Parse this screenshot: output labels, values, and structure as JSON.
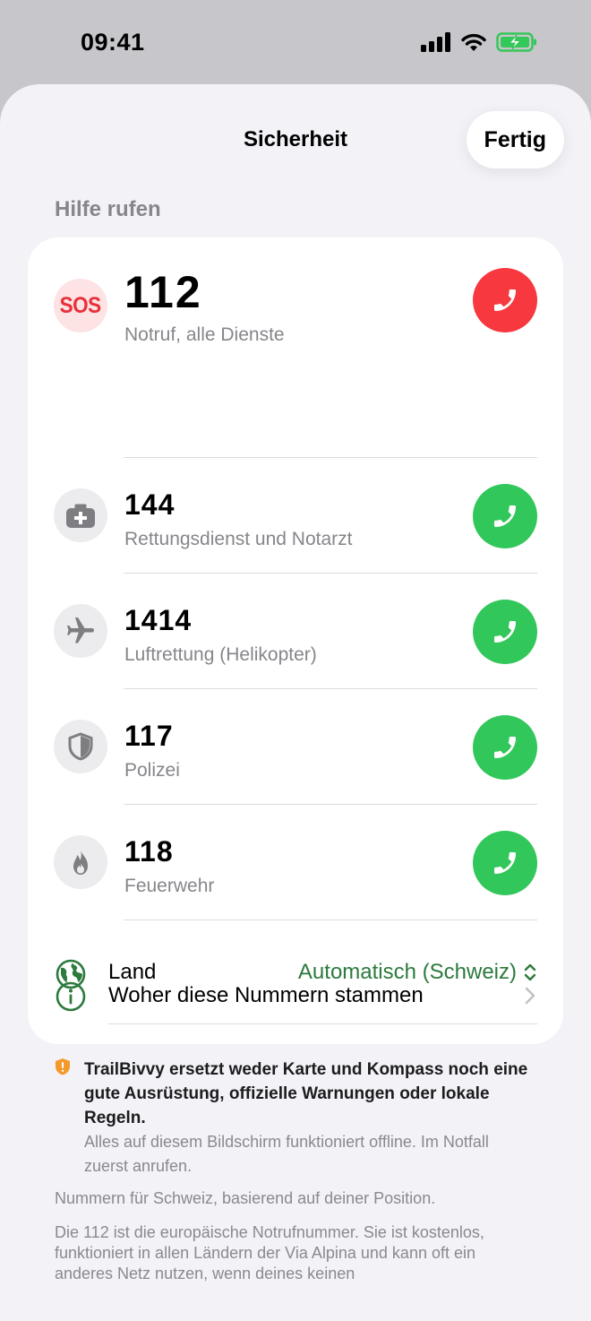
{
  "status_bar": {
    "time": "09:41"
  },
  "sheet": {
    "title": "Sicherheit",
    "done_label": "Fertig"
  },
  "section": {
    "header": "Hilfe rufen"
  },
  "contacts": [
    {
      "icon": "sos-icon",
      "number": "112",
      "description": "Notruf, alle Dienste",
      "call_color": "#f7383f"
    },
    {
      "icon": "medical-kit-icon",
      "number": "144",
      "description": "Rettungsdienst und Notarzt",
      "call_color": "#32c75a"
    },
    {
      "icon": "airplane-icon",
      "number": "1414",
      "description": "Luftrettung (Helikopter)",
      "call_color": "#32c75a"
    },
    {
      "icon": "shield-icon",
      "number": "117",
      "description": "Polizei",
      "call_color": "#32c75a"
    },
    {
      "icon": "flame-icon",
      "number": "118",
      "description": "Feuerwehr",
      "call_color": "#32c75a"
    }
  ],
  "sos_icon_text": "SOS",
  "country": {
    "label": "Land",
    "value": "Automatisch (Schweiz)"
  },
  "source": {
    "label": "Woher diese Nummern stammen"
  },
  "notice": {
    "bold": "TrailBivvy ersetzt weder Karte und Kompass noch eine gute Ausrüstung, offizielle Warnungen oder lokale Regeln.",
    "sub": "Alles auf diesem Bildschirm funktioniert offline. Im Notfall zuerst anrufen."
  },
  "footnotes": {
    "line1": "Nummern für Schweiz, basierend auf deiner Position.",
    "line2": "Die 112 ist die europäische Notrufnummer. Sie ist kostenlos, funktioniert in allen Ländern der Via Alpina und kann oft ein anderes Netz nutzen, wenn deines keinen"
  },
  "colors": {
    "accent_green": "#2c7a3d",
    "call_green": "#32c75a",
    "call_red": "#f7383f",
    "warning_orange": "#f39a2b"
  }
}
